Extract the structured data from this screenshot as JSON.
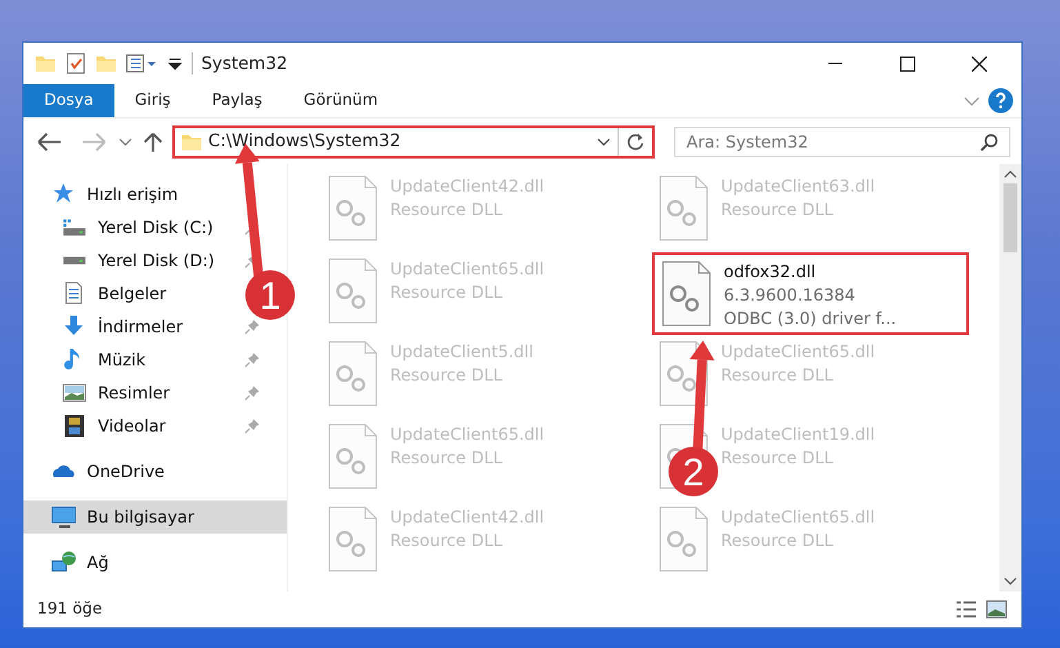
{
  "window": {
    "title": "System32"
  },
  "ribbon_tabs": [
    {
      "label": "Dosya",
      "selected": true
    },
    {
      "label": "Giriş",
      "selected": false
    },
    {
      "label": "Paylaş",
      "selected": false
    },
    {
      "label": "Görünüm",
      "selected": false
    }
  ],
  "address": {
    "path": "C:\\Windows\\System32",
    "highlighted": true
  },
  "search": {
    "placeholder": "Ara: System32"
  },
  "sidebar": {
    "items": [
      {
        "label": "Hızlı erişim",
        "selected": false,
        "children": [
          {
            "label": "Yerel Disk (C:)",
            "pinned": true
          },
          {
            "label": "Yerel Disk (D:)",
            "pinned": true
          },
          {
            "label": "Belgeler"
          },
          {
            "label": "İndirmeler",
            "pinned": true
          },
          {
            "label": "Müzik",
            "pinned": true
          },
          {
            "label": "Resimler",
            "pinned": true
          },
          {
            "label": "Videolar",
            "pinned": true
          }
        ]
      },
      {
        "label": "OneDrive",
        "selected": false
      },
      {
        "label": "Bu bilgisayar",
        "selected": true
      },
      {
        "label": "Ağ",
        "selected": false
      }
    ]
  },
  "files": [
    {
      "name": "UpdateClient42.dll",
      "details": [
        "Resource DLL"
      ],
      "blurred": true,
      "highlighted": false
    },
    {
      "name": "UpdateClient63.dll",
      "details": [
        "Resource DLL"
      ],
      "blurred": true,
      "highlighted": false
    },
    {
      "name": "UpdateClient65.dll",
      "details": [
        "Resource DLL"
      ],
      "blurred": true,
      "highlighted": false
    },
    {
      "name": "odfox32.dll",
      "details": [
        "6.3.9600.16384",
        "ODBC (3.0) driver f..."
      ],
      "blurred": false,
      "highlighted": true
    },
    {
      "name": "UpdateClient5.dll",
      "details": [
        "Resource DLL"
      ],
      "blurred": true,
      "highlighted": false
    },
    {
      "name": "UpdateClient65.dll",
      "details": [
        "Resource DLL"
      ],
      "blurred": true,
      "highlighted": false
    },
    {
      "name": "UpdateClient65.dll",
      "details": [
        "Resource DLL"
      ],
      "blurred": true,
      "highlighted": false
    },
    {
      "name": "UpdateClient19.dll",
      "details": [
        "Resource DLL"
      ],
      "blurred": true,
      "highlighted": false
    },
    {
      "name": "UpdateClient42.dll",
      "details": [
        "Resource DLL"
      ],
      "blurred": true,
      "highlighted": false
    },
    {
      "name": "UpdateClient65.dll",
      "details": [
        "Resource DLL"
      ],
      "blurred": true,
      "highlighted": false
    }
  ],
  "status_bar": {
    "item_count": "191 öğe"
  },
  "callouts": [
    {
      "number": "1"
    },
    {
      "number": "2"
    }
  ]
}
